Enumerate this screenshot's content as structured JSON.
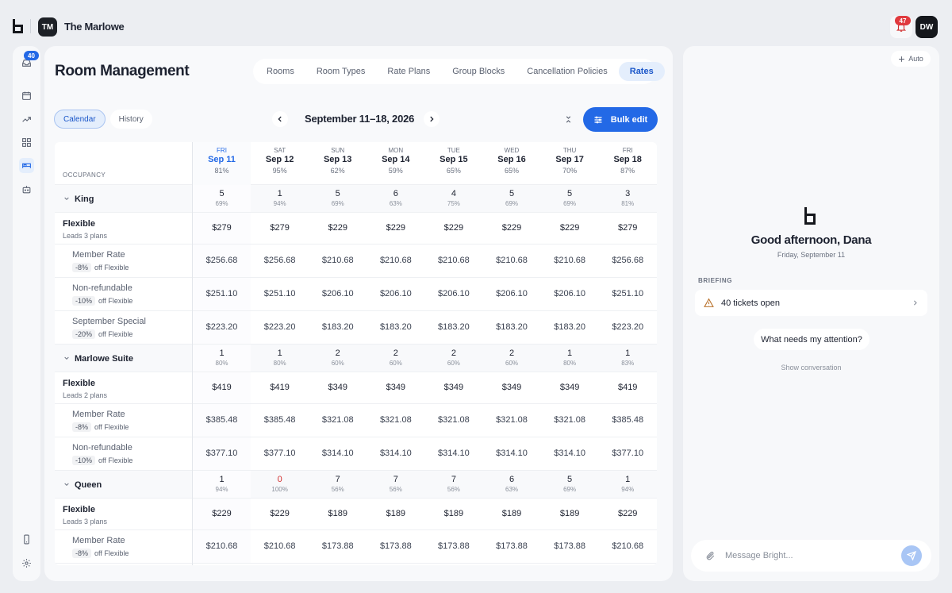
{
  "topbar": {
    "property_initials": "TM",
    "property_name": "The Marlowe",
    "notifications_count": "47",
    "user_initials": "DW"
  },
  "rail": {
    "inbox_badge": "40",
    "items": [
      "inbox-icon",
      "calendar-icon",
      "trend-icon",
      "grid-icon",
      "bed-icon",
      "robot-icon",
      "phone-icon",
      "settings-icon"
    ]
  },
  "main": {
    "title": "Room Management",
    "tabs": [
      {
        "label": "Rooms",
        "active": false
      },
      {
        "label": "Room Types",
        "active": false
      },
      {
        "label": "Rate Plans",
        "active": false
      },
      {
        "label": "Group Blocks",
        "active": false
      },
      {
        "label": "Cancellation Policies",
        "active": false
      },
      {
        "label": "Rates",
        "active": true
      }
    ],
    "view_toggle": {
      "calendar": "Calendar",
      "history": "History"
    },
    "date_range": "September 11–18, 2026",
    "bulk_edit": "Bulk edit",
    "occupancy_label": "OCCUPANCY",
    "days": [
      {
        "dow": "FRI",
        "date": "Sep 11",
        "occ": "81%",
        "today": true
      },
      {
        "dow": "SAT",
        "date": "Sep 12",
        "occ": "95%",
        "today": false
      },
      {
        "dow": "SUN",
        "date": "Sep 13",
        "occ": "62%",
        "today": false
      },
      {
        "dow": "MON",
        "date": "Sep 14",
        "occ": "59%",
        "today": false
      },
      {
        "dow": "TUE",
        "date": "Sep 15",
        "occ": "65%",
        "today": false
      },
      {
        "dow": "WED",
        "date": "Sep 16",
        "occ": "65%",
        "today": false
      },
      {
        "dow": "THU",
        "date": "Sep 17",
        "occ": "70%",
        "today": false
      },
      {
        "dow": "FRI",
        "date": "Sep 18",
        "occ": "87%",
        "today": false
      }
    ],
    "rows": [
      {
        "kind": "group",
        "name": "King",
        "inv": [
          "5",
          "1",
          "5",
          "6",
          "4",
          "5",
          "5",
          "3"
        ],
        "pct": [
          "69%",
          "94%",
          "69%",
          "63%",
          "75%",
          "69%",
          "69%",
          "81%"
        ]
      },
      {
        "kind": "base",
        "name": "Flexible",
        "desc": "Leads 3 plans",
        "prices": [
          "$279",
          "$279",
          "$229",
          "$229",
          "$229",
          "$229",
          "$229",
          "$279"
        ]
      },
      {
        "kind": "sub",
        "name": "Member Rate",
        "discount": "-8%",
        "off": "off Flexible",
        "prices": [
          "$256.68",
          "$256.68",
          "$210.68",
          "$210.68",
          "$210.68",
          "$210.68",
          "$210.68",
          "$256.68"
        ]
      },
      {
        "kind": "sub",
        "name": "Non-refundable",
        "discount": "-10%",
        "off": "off Flexible",
        "prices": [
          "$251.10",
          "$251.10",
          "$206.10",
          "$206.10",
          "$206.10",
          "$206.10",
          "$206.10",
          "$251.10"
        ]
      },
      {
        "kind": "sub",
        "name": "September Special",
        "discount": "-20%",
        "off": "off Flexible",
        "prices": [
          "$223.20",
          "$223.20",
          "$183.20",
          "$183.20",
          "$183.20",
          "$183.20",
          "$183.20",
          "$223.20"
        ]
      },
      {
        "kind": "group",
        "name": "Marlowe Suite",
        "inv": [
          "1",
          "1",
          "2",
          "2",
          "2",
          "2",
          "1",
          "1"
        ],
        "pct": [
          "80%",
          "80%",
          "60%",
          "60%",
          "60%",
          "60%",
          "80%",
          "83%"
        ]
      },
      {
        "kind": "base",
        "name": "Flexible",
        "desc": "Leads 2 plans",
        "prices": [
          "$419",
          "$419",
          "$349",
          "$349",
          "$349",
          "$349",
          "$349",
          "$419"
        ]
      },
      {
        "kind": "sub",
        "name": "Member Rate",
        "discount": "-8%",
        "off": "off Flexible",
        "prices": [
          "$385.48",
          "$385.48",
          "$321.08",
          "$321.08",
          "$321.08",
          "$321.08",
          "$321.08",
          "$385.48"
        ]
      },
      {
        "kind": "sub",
        "name": "Non-refundable",
        "discount": "-10%",
        "off": "off Flexible",
        "prices": [
          "$377.10",
          "$377.10",
          "$314.10",
          "$314.10",
          "$314.10",
          "$314.10",
          "$314.10",
          "$377.10"
        ]
      },
      {
        "kind": "group",
        "name": "Queen",
        "inv": [
          "1",
          "0",
          "7",
          "7",
          "7",
          "6",
          "5",
          "1"
        ],
        "pct": [
          "94%",
          "100%",
          "56%",
          "56%",
          "56%",
          "63%",
          "69%",
          "94%"
        ]
      },
      {
        "kind": "base",
        "name": "Flexible",
        "desc": "Leads 3 plans",
        "prices": [
          "$229",
          "$229",
          "$189",
          "$189",
          "$189",
          "$189",
          "$189",
          "$229"
        ]
      },
      {
        "kind": "sub",
        "name": "Member Rate",
        "discount": "-8%",
        "off": "off Flexible",
        "prices": [
          "$210.68",
          "$210.68",
          "$173.88",
          "$173.88",
          "$173.88",
          "$173.88",
          "$173.88",
          "$210.68"
        ]
      }
    ]
  },
  "assistant": {
    "auto_label": "Auto",
    "greeting": "Good afternoon, Dana",
    "date": "Friday, September 11",
    "briefing_label": "BRIEFING",
    "tickets": "40 tickets open",
    "suggestion": "What needs my attention?",
    "show_conversation": "Show conversation",
    "composer_placeholder": "Message Bright..."
  },
  "colors": {
    "accent": "#2369e6",
    "accent_soft": "#e4eefc",
    "alert": "#e0393e",
    "sold_out": "#d23030"
  }
}
